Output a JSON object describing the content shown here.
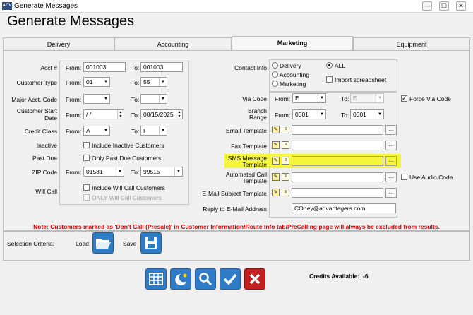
{
  "window": {
    "title": "Generate Messages",
    "app_icon_text": "ADV"
  },
  "heading": "Generate Messages",
  "tabs": [
    "Delivery",
    "Accounting",
    "Marketing",
    "Equipment"
  ],
  "labels": {
    "acct": "Acct #",
    "customer_type": "Customer Type",
    "major_acct_code": "Major Acct. Code",
    "customer_start_date_1": "Customer Start",
    "customer_start_date_2": "Date",
    "credit_class": "Credit Class",
    "inactive": "Inactive",
    "past_due": "Past Due",
    "zip_code": "ZIP Code",
    "will_call": "Will Call",
    "from": "From:",
    "to": "To:",
    "contact_info": "Contact Info",
    "via_code": "Via Code",
    "branch_range_1": "Branch",
    "branch_range_2": "Range",
    "email_template": "Email Template",
    "fax_template": "Fax Template",
    "sms_template_1": "SMS Message",
    "sms_template_2": "Template",
    "auto_call_1": "Automated Call",
    "auto_call_2": "Template",
    "email_subject": "E-Mail Subject Template",
    "reply_to": "Reply to E-Mail Address"
  },
  "values": {
    "acct_from": "001003",
    "acct_to": "001003",
    "customer_type_from": "01",
    "customer_type_to": "55",
    "major_acct_from": "",
    "major_acct_to": "",
    "start_date_from": "/ /",
    "start_date_to": "08/15/2025",
    "credit_class_from": "A",
    "credit_class_to": "F",
    "zip_from": "01581",
    "zip_to": "99515",
    "via_code_from": "E",
    "via_code_to": "E",
    "branch_from": "0001",
    "branch_to": "0001",
    "reply_to_email": "COney@advantagers.com"
  },
  "checkboxes": {
    "include_inactive": "Include Inactive Customers",
    "only_past_due": "Only Past Due Customers",
    "include_will_call": "Include Will Call Customers",
    "only_will_call": "ONLY Will Call Customers",
    "import_spreadsheet": "Import spreadsheet",
    "force_via_code": "Force Via Code",
    "use_audio_code": "Use Audio Code"
  },
  "radios": {
    "delivery": "Delivery",
    "accounting": "Accounting",
    "marketing": "Marketing",
    "all": "ALL"
  },
  "note": "Note: Customers marked as 'Don't Call (Presale)' in Customer Information/Route Info tab/PreCalling page will always be excluded from results.",
  "selection": {
    "label": "Selection Criteria:",
    "load": "Load",
    "save": "Save"
  },
  "credits": {
    "label": "Credits Available:",
    "value": "-6"
  },
  "glyphs": {
    "ellipsis": "...",
    "dropdown": "▼",
    "spin_up": "▲",
    "spin_down": "▼",
    "min": "—",
    "max": "☐",
    "close": "✕"
  },
  "colors": {
    "highlight": "#f5f53c",
    "note_red": "#e00000",
    "button_blue": "#2e7bc8",
    "button_red": "#c42020"
  }
}
